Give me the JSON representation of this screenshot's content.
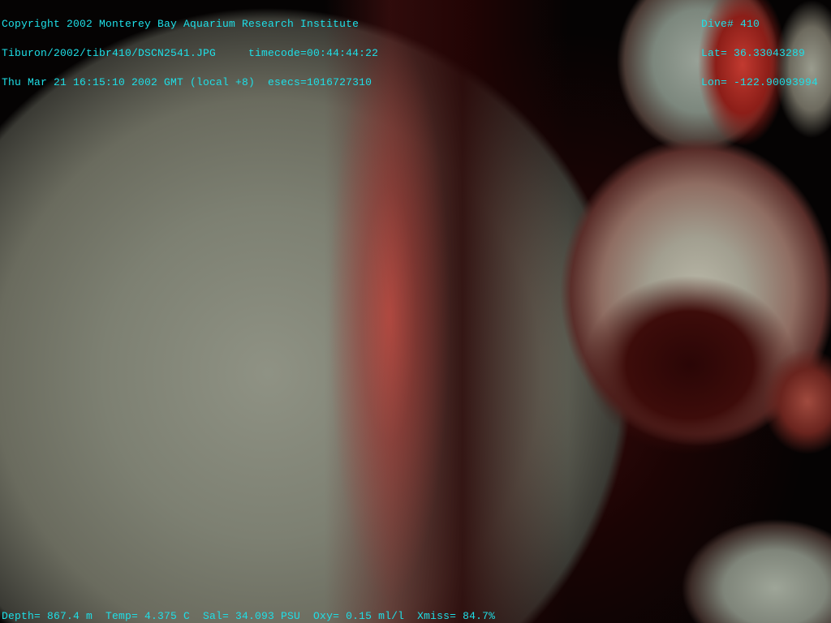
{
  "overlay": {
    "top_left": [
      "Copyright 2002 Monterey Bay Aquarium Research Institute",
      "Tiburon/2002/tibr410/DSCN2541.JPG     timecode=00:44:44:22",
      "Thu Mar 21 16:15:10 2002 GMT (local +8)  esecs=1016727310"
    ],
    "top_right": [
      "Dive# 410",
      "Lat= 36.33043289",
      "Lon= -122.90093994"
    ],
    "bottom": "Depth= 867.4 m  Temp= 4.375 C  Sal= 34.093 PSU  Oxy= 0.15 ml/l  Xmiss= 84.7%"
  },
  "colors": {
    "overlay_text": "#1ee0e8"
  }
}
